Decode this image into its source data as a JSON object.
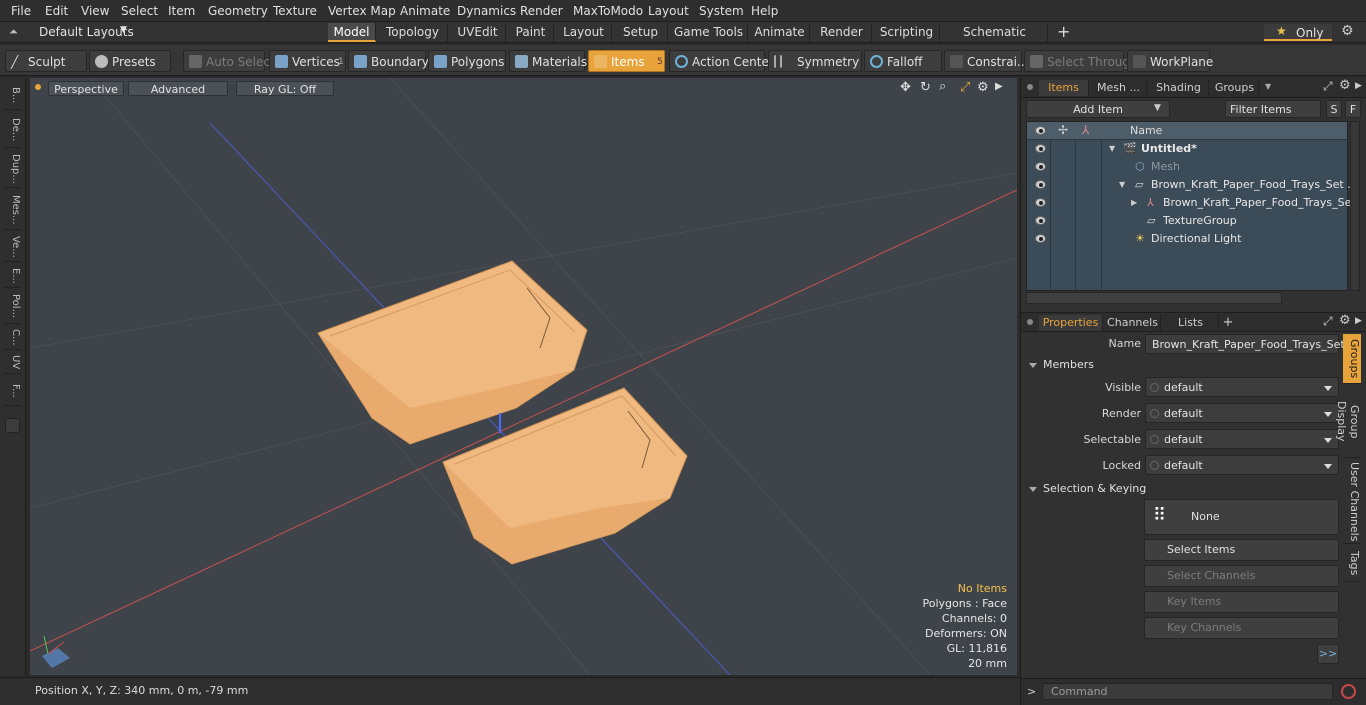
{
  "menu": [
    "File",
    "Edit",
    "View",
    "Select",
    "Item",
    "Geometry",
    "Texture",
    "Vertex Map",
    "Animate",
    "Dynamics",
    "Render",
    "MaxToModo",
    "Layout",
    "System",
    "Help"
  ],
  "layout_selector": "Default Layouts",
  "mode_tabs": [
    "Model",
    "Topology",
    "UVEdit",
    "Paint",
    "Layout",
    "Setup",
    "Game Tools",
    "Animate",
    "Render",
    "Scripting",
    "Schematic Fusion"
  ],
  "only_label": "Only",
  "toolbar": {
    "sculpt": "Sculpt",
    "presets": "Presets",
    "auto_select": "Auto Select",
    "vertices": "Vertices",
    "vertices_count": "1",
    "boundary": "Boundary",
    "polygons": "Polygons",
    "materials": "Materials",
    "items": "Items",
    "items_count": "5",
    "action_center": "Action Center",
    "symmetry": "Symmetry",
    "falloff": "Falloff",
    "constraints": "Constrai...",
    "select_through": "Select Through",
    "workplane": "WorkPlane"
  },
  "left_tabs": [
    "B...",
    "De...",
    "Dup...",
    "Mes...",
    "Ve...",
    "E...",
    "Pol...",
    "C...",
    "UV",
    "F..."
  ],
  "viewport": {
    "perspective": "Perspective",
    "advanced": "Advanced",
    "raygl": "Ray GL: Off",
    "info": {
      "no_items": "No Items",
      "polygons": "Polygons : Face",
      "channels": "Channels: 0",
      "deformers": "Deformers: ON",
      "gl": "GL: 11,816",
      "size": "20 mm"
    }
  },
  "status": {
    "position": "Position X, Y, Z:  340 mm, 0 m, -79 mm"
  },
  "items_panel": {
    "tabs": [
      "Items",
      "Mesh ...",
      "Shading",
      "Groups"
    ],
    "add_item": "Add Item",
    "filter_items": "Filter Items",
    "s_btn": "S",
    "f_btn": "F",
    "column_name": "Name",
    "tree": [
      "Untitled*",
      "Mesh",
      "Brown_Kraft_Paper_Food_Trays_Set ...",
      "Brown_Kraft_Paper_Food_Trays_Set",
      "TextureGroup",
      "Directional Light"
    ]
  },
  "properties": {
    "tabs": [
      "Properties",
      "Channels",
      "Lists",
      "+"
    ],
    "name_label": "Name",
    "name_value": "Brown_Kraft_Paper_Food_Trays_Set",
    "members": "Members",
    "rows": [
      {
        "label": "Visible",
        "value": "default"
      },
      {
        "label": "Render",
        "value": "default"
      },
      {
        "label": "Selectable",
        "value": "default"
      },
      {
        "label": "Locked",
        "value": "default"
      }
    ],
    "selection_keying": "Selection & Keying",
    "none": "None",
    "select_items": "Select Items",
    "select_channels": "Select Channels",
    "key_items": "Key Items",
    "key_channels": "Key Channels",
    "more": ">>",
    "side_tabs": [
      "Groups",
      "Group Display",
      "User Channels",
      "Tags"
    ]
  },
  "command": {
    "placeholder": "Command"
  }
}
